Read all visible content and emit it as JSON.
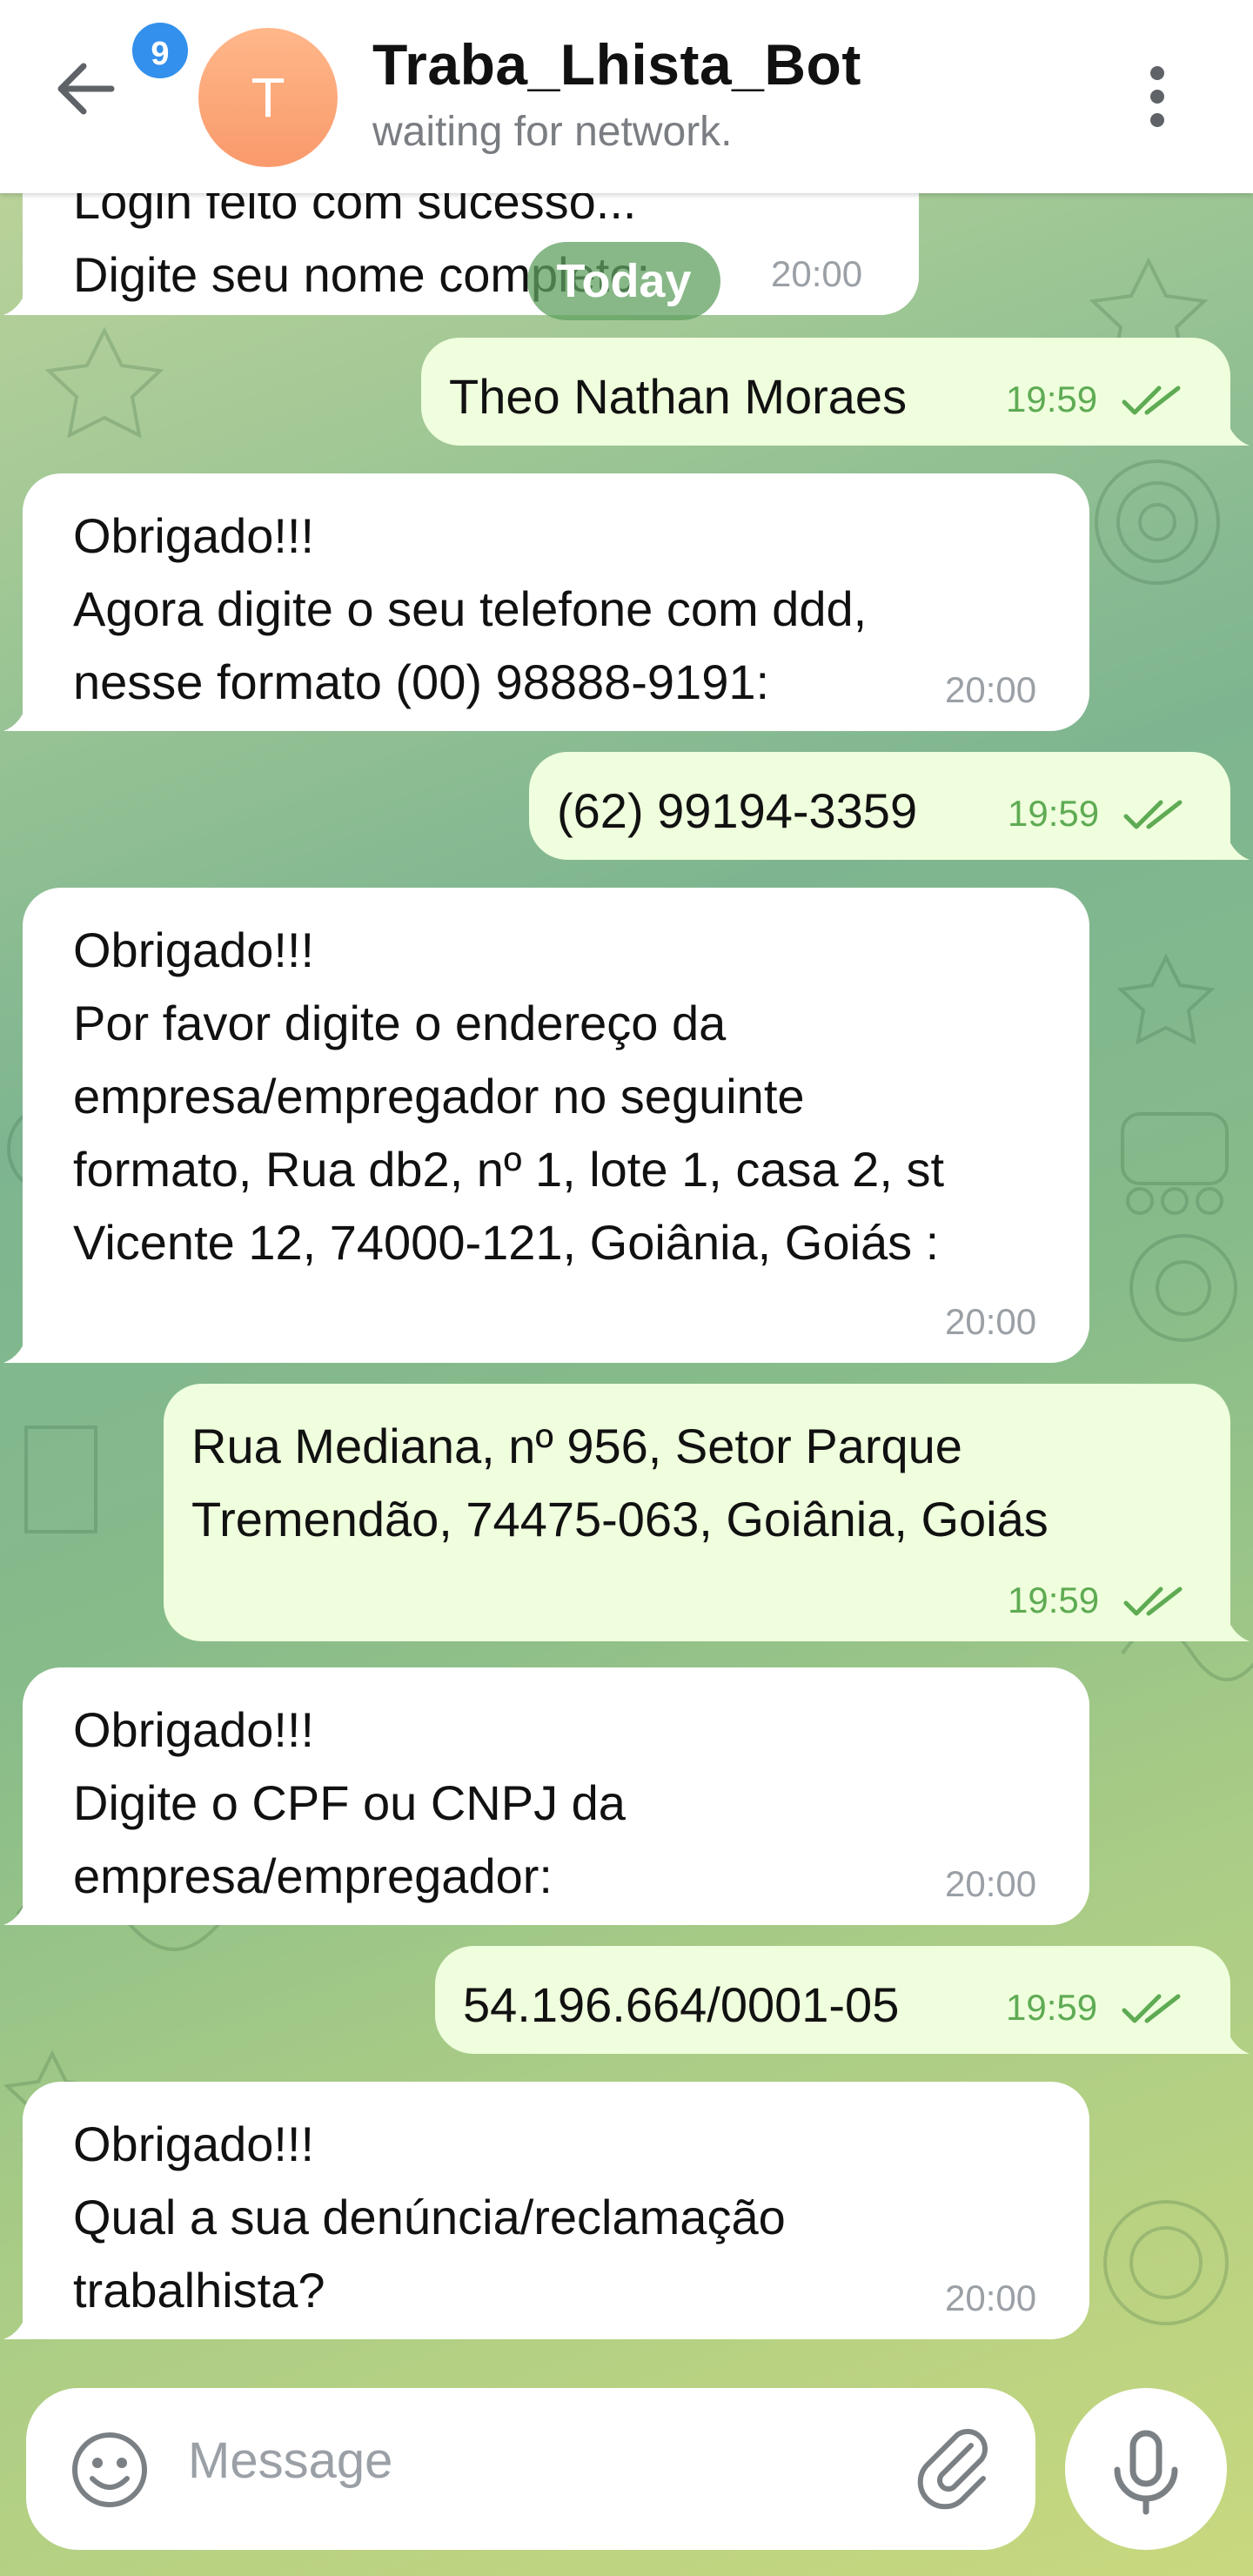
{
  "header": {
    "unread_count": "9",
    "avatar_letter": "T",
    "title": "Traba_Lhista_Bot",
    "status": "waiting for network."
  },
  "date_separator": "Today",
  "messages": [
    {
      "dir": "in",
      "text": "Login feito com sucesso...\nDigite seu nome completo:",
      "time": "20:00"
    },
    {
      "dir": "out",
      "text": "Theo Nathan Moraes",
      "time": "19:59"
    },
    {
      "dir": "in",
      "text": "Obrigado!!!\nAgora digite o seu telefone com ddd,\nnesse formato (00) 98888-9191:",
      "time": "20:00"
    },
    {
      "dir": "out",
      "text": "(62) 99194-3359",
      "time": "19:59"
    },
    {
      "dir": "in",
      "text": "Obrigado!!!\nPor favor digite o endereço da\nempresa/empregador no seguinte\nformato, Rua db2, nº 1, lote 1, casa 2, st\nVicente 12, 74000-121, Goiânia, Goiás :",
      "time": "20:00"
    },
    {
      "dir": "out",
      "text": "Rua Mediana, nº 956, Setor Parque\nTremendão, 74475-063, Goiânia, Goiás",
      "time": "19:59"
    },
    {
      "dir": "in",
      "text": "Obrigado!!!\nDigite o CPF ou CNPJ da\nempresa/empregador:",
      "time": "20:00"
    },
    {
      "dir": "out",
      "text": "54.196.664/0001-05",
      "time": "19:59"
    },
    {
      "dir": "in",
      "text": "Obrigado!!!\nQual a sua denúncia/reclamação\ntrabalhista?",
      "time": "20:00"
    }
  ],
  "composer": {
    "placeholder": "Message"
  },
  "icons": {
    "back": "arrow-left-icon",
    "menu": "more-vertical-icon",
    "emoji": "smiley-icon",
    "attach": "paperclip-icon",
    "mic": "microphone-icon",
    "read": "double-check-icon"
  },
  "colors": {
    "header_bg": "#ffffff",
    "incoming_bubble": "#ffffff",
    "outgoing_bubble": "#effedd",
    "outgoing_time": "#5eab53",
    "badge": "#3390ec",
    "avatar": "#f99a6b"
  }
}
